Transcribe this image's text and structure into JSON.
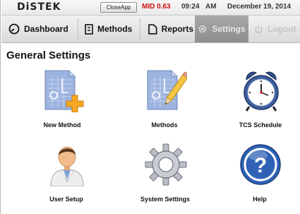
{
  "status": {
    "logo": "DiSTEK",
    "close_app": "CloseApp",
    "mid": "MID 0.63",
    "time": "09:24",
    "ampm": "AM",
    "date": "December 19, 2014"
  },
  "nav": {
    "dashboard": "Dashboard",
    "methods": "Methods",
    "reports": "Reports",
    "settings": "Settings",
    "logout": "Logout"
  },
  "page_title": "General Settings",
  "tiles": [
    {
      "label": "New Method",
      "icon": "new-method-icon"
    },
    {
      "label": "Methods",
      "icon": "methods-icon"
    },
    {
      "label": "TCS Schedule",
      "icon": "alarm-clock-icon"
    },
    {
      "label": "User Setup",
      "icon": "user-icon"
    },
    {
      "label": "System Settings",
      "icon": "gear-icon"
    },
    {
      "label": "Help",
      "icon": "help-icon"
    }
  ],
  "colors": {
    "mid_red": "#d01010",
    "active_tab": "#9c9c9c",
    "help_blue": "#2f62b6"
  }
}
